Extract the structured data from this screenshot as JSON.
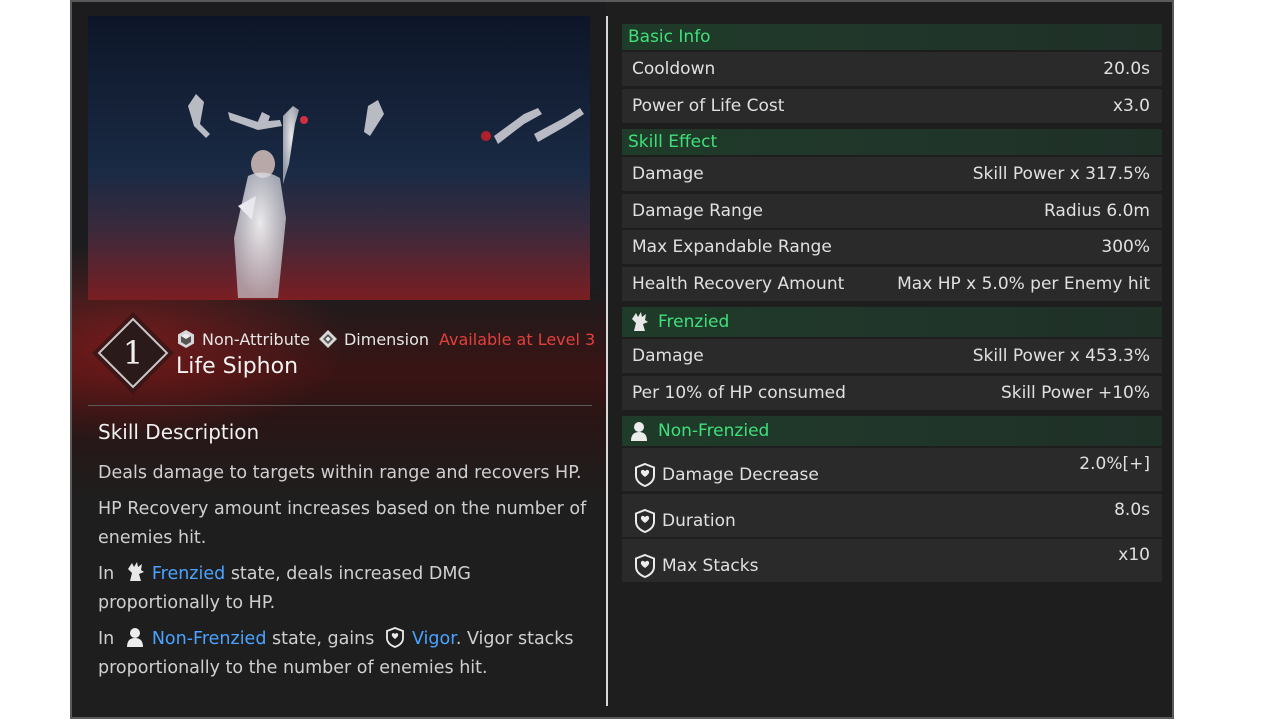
{
  "skill": {
    "level": "1",
    "attribute": "Non-Attribute",
    "type": "Dimension",
    "availability": "Available at Level 3",
    "name": "Life Siphon"
  },
  "description": {
    "title": "Skill Description",
    "line1": "Deals damage to targets within range and recovers HP.",
    "line2": "HP Recovery amount increases based on the number of enemies hit.",
    "p3_prefix": "In",
    "p3_keyword": "Frenzied",
    "p3_suffix": "state, deals increased DMG proportionally to HP.",
    "p4_prefix": "In",
    "p4_keyword": "Non-Frenzied",
    "p4_mid": "state, gains",
    "p4_keyword2": "Vigor",
    "p4_suffix": ". Vigor stacks proportionally to the number of enemies hit."
  },
  "stats": {
    "basic_info": {
      "title": "Basic Info",
      "rows": [
        {
          "label": "Cooldown",
          "value": "20.0s"
        },
        {
          "label": "Power of Life Cost",
          "value": "x3.0"
        }
      ]
    },
    "skill_effect": {
      "title": "Skill Effect",
      "rows": [
        {
          "label": "Damage",
          "value": "Skill Power x 317.5%"
        },
        {
          "label": "Damage Range",
          "value": "Radius 6.0m"
        },
        {
          "label": "Max Expandable Range",
          "value": "300%"
        },
        {
          "label": "Health Recovery Amount",
          "value": "Max HP x 5.0% per Enemy hit"
        }
      ]
    },
    "frenzied": {
      "title": "Frenzied",
      "rows": [
        {
          "label": "Damage",
          "value": "Skill Power x 453.3%"
        },
        {
          "label": "Per 10% of HP consumed",
          "value": "Skill Power +10%"
        }
      ]
    },
    "non_frenzied": {
      "title": "Non-Frenzied",
      "rows": [
        {
          "label": "Damage Decrease",
          "value": "2.0%[+]"
        },
        {
          "label": "Duration",
          "value": "8.0s"
        },
        {
          "label": "Max Stacks",
          "value": "x10"
        }
      ]
    }
  },
  "colors": {
    "section_text": "#3fe07a",
    "keyword": "#4aa3ff",
    "availability": "#e2403c"
  }
}
